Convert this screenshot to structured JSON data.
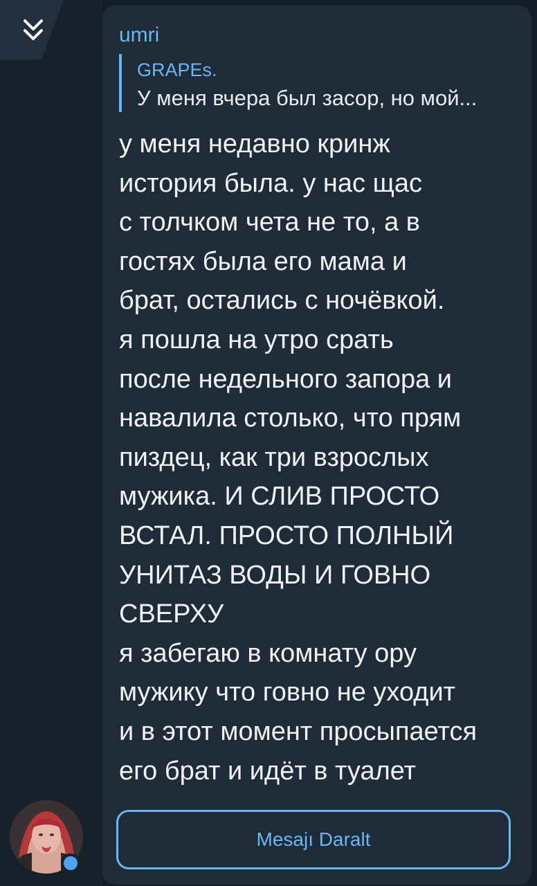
{
  "header": {
    "collapse_icon": "chevron-double-down-icon"
  },
  "message": {
    "sender": "umri",
    "reply": {
      "author": "GRAPEѕ.",
      "text": "У меня вчера был засор, но мой..."
    },
    "lines": [
      "у меня недавно кринж",
      "история была. у нас щас",
      "с толчком чета не то, а в",
      "гостях была его мама и",
      "брат, остались с ночёвкой.",
      "я пошла на утро срать",
      "после недельного запора и",
      "навалила столько, что прям",
      "пиздец, как три взрослых",
      "мужика. И СЛИВ ПРОСТО",
      "ВСТАЛ. ПРОСТО ПОЛНЫЙ",
      "УНИТАЗ ВОДЫ И ГОВНО",
      "СВЕРХУ",
      "я забегаю в комнату ору",
      "мужику что говно не уходит",
      "и в этот момент просыпается",
      "его брат и идёт в туалет"
    ]
  },
  "footer": {
    "button_label": "Mesajı Daralt",
    "avatar_status": "online"
  },
  "colors": {
    "accent": "#6ab7f5",
    "bubble": "#1f2b37",
    "background": "#131c27",
    "text": "#f0f3f6",
    "online": "#4da3f0"
  }
}
